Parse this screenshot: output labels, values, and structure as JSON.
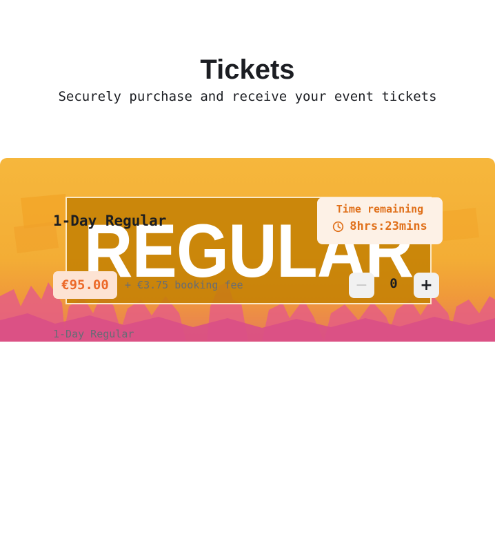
{
  "header": {
    "title": "Tickets",
    "subtitle": "Securely purchase and receive your event tickets"
  },
  "ticket": {
    "banner_text": "REGULAR",
    "name": "1-Day Regular",
    "timer": {
      "label": "Time remaining",
      "value": "8hrs:23mins",
      "icon": "clock-icon"
    },
    "price": "€95.00",
    "booking_fee": "+ €3.75 booking fee",
    "quantity": {
      "decrement_label": "−",
      "value": "0",
      "increment_label": "+"
    },
    "description": "1-Day Regular"
  },
  "colors": {
    "accent": "#ec6a2a",
    "timer_text": "#e0701a",
    "banner_yellow": "#f6b73c",
    "banner_box": "#c48004"
  }
}
